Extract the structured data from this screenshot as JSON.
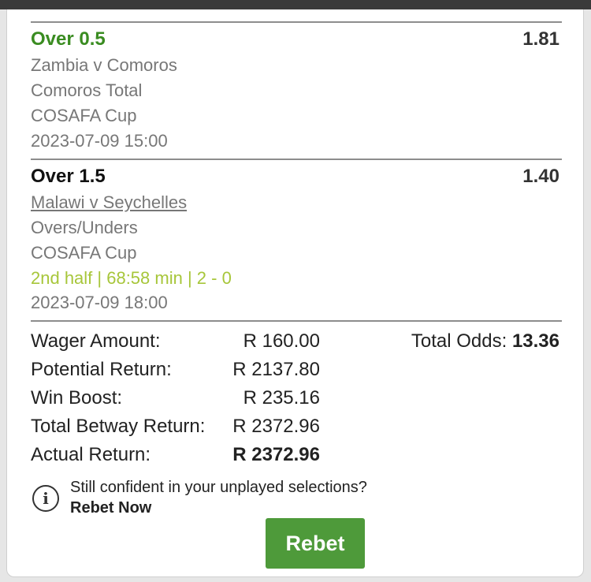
{
  "selections": [
    {
      "title": "Over 0.5",
      "odds": "1.81",
      "match": "Zambia v Comoros",
      "market": "Comoros Total",
      "competition": "COSAFA Cup",
      "datetime": "2023-07-09 15:00"
    },
    {
      "title": "Over 1.5",
      "odds": "1.40",
      "match": "Malawi v Seychelles",
      "market": "Overs/Unders",
      "competition": "COSAFA Cup",
      "live_status": "2nd half | 68:58 min | 2 - 0",
      "datetime": "2023-07-09 18:00"
    }
  ],
  "summary": {
    "wager_label": "Wager Amount:",
    "wager_value": "R 160.00",
    "potential_label": "Potential Return:",
    "potential_value": "R 2137.80",
    "boost_label": "Win Boost:",
    "boost_value": "R 235.16",
    "total_label": "Total Betway Return:",
    "total_value": "R 2372.96",
    "actual_label": "Actual Return:",
    "actual_value": "R 2372.96",
    "total_odds_label": "Total Odds:",
    "total_odds_value": "13.36"
  },
  "rebet": {
    "prompt": "Still confident in your unplayed selections?",
    "cta": "Rebet Now",
    "button_label": "Rebet"
  },
  "colors": {
    "won_title": "#3a8c21",
    "live_status": "#a7c63a",
    "rebet_button": "#4e9a3a"
  }
}
